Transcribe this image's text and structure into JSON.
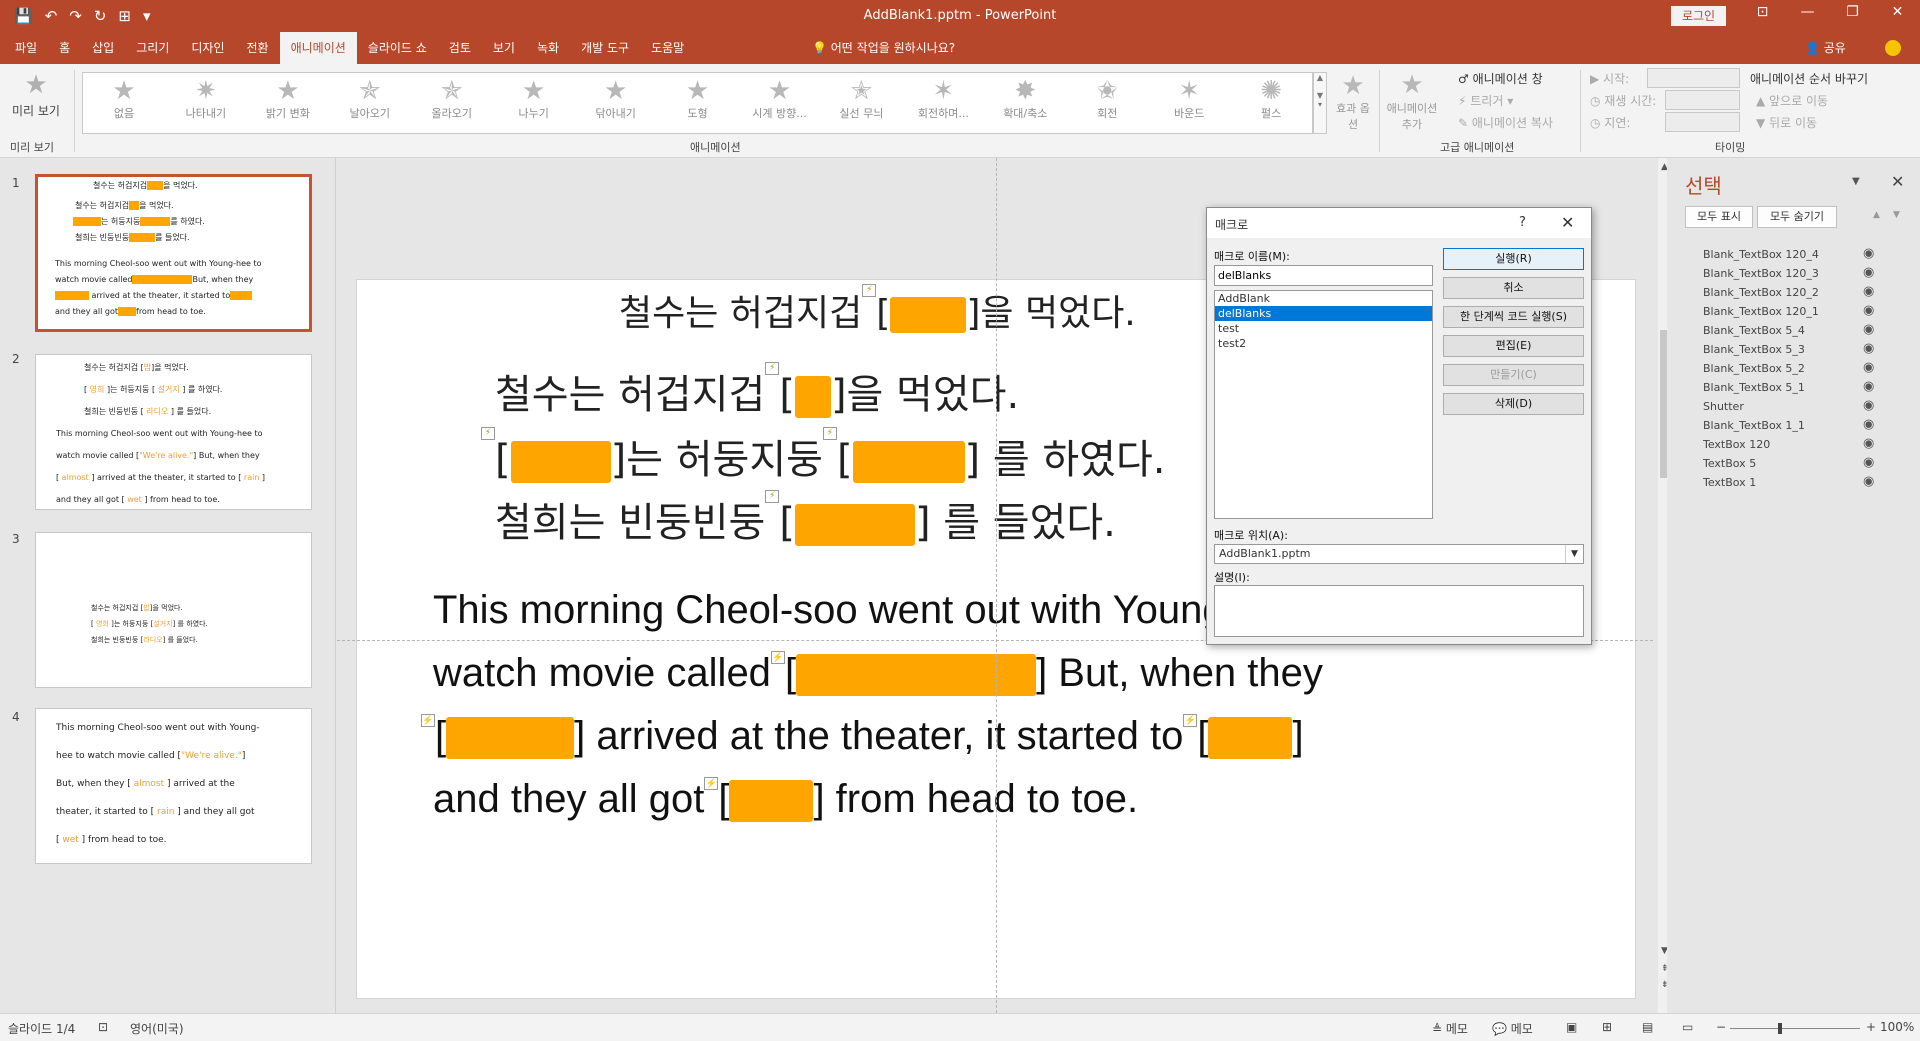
{
  "app": {
    "title": "AddBlank1.pptm - PowerPoint",
    "login": "로그인",
    "qat": [
      "💾",
      "↶",
      "↷",
      "↻",
      "⊞",
      "▾"
    ],
    "window_controls": [
      "⊡",
      "—",
      "❐",
      "✕"
    ]
  },
  "tabs": [
    "파일",
    "홈",
    "삽입",
    "그리기",
    "디자인",
    "전환",
    "애니메이션",
    "슬라이드 쇼",
    "검토",
    "보기",
    "녹화",
    "개발 도구",
    "도움말"
  ],
  "tell_me": "💡 어떤 작업을 원하시나요?",
  "share": "👤 공유",
  "ribbon": {
    "preview_label": "미리 보기",
    "preview_group": "미리 보기",
    "animations": [
      "없음",
      "나타내기",
      "밝기 변화",
      "날아오기",
      "올라오기",
      "나누기",
      "닦아내기",
      "도형",
      "시계 방향...",
      "실선 무늬",
      "회전하며...",
      "확대/축소",
      "회전",
      "바운드",
      "펄스"
    ],
    "effect_options": "효과 옵션",
    "animation_group": "애니메이션",
    "add_animation": "애니메이션 추가",
    "animation_pane": "애니메이션 창",
    "trigger": "트리거",
    "anim_painter": "애니메이션 복사",
    "advanced_group": "고급 애니메이션",
    "start": "시작:",
    "duration": "재생 시간:",
    "delay": "지연:",
    "reorder": "애니메이션 순서 바꾸기",
    "move_earlier": "앞으로 이동",
    "move_later": "뒤로 이동",
    "timing_group": "타이밍"
  },
  "thumbnails": {
    "numbers": [
      "1",
      "2",
      "3",
      "4"
    ],
    "t1": {
      "l1": "철수는 허겁지겁",
      "l1b": "을 먹었다.",
      "l2": "철수는 허겁지겁",
      "l2b": "을 먹었다.",
      "l3b": "는 허둥지둥",
      "l3c": "를 하였다.",
      "l4": "철희는 빈둥빈둥",
      "l4b": "를 들었다.",
      "e1": "This morning Cheol-soo went out with Young-hee to",
      "e2": "watch movie called",
      "e2b": "But, when they",
      "e3": "arrived at the theater, it started to",
      "e4": "and they all got",
      "e4b": "from head to toe."
    },
    "t2": {
      "l1": "철수는 허겁지겁",
      "w1": "밥",
      "l1b": "을 먹었다.",
      "w2": "영희",
      "l2b": "는 허둥지둥",
      "w3": "설거지",
      "l2c": "를 하였다.",
      "l3": "철희는 빈둥빈둥",
      "w4": "라디오",
      "l3b": "를 들었다.",
      "e1": "This morning Cheol-soo went out with Young-hee to",
      "e2": "watch movie called",
      "w5": "\"We're alive.\"",
      "e2b": "But, when they",
      "w6": "almost",
      "e3": "arrived at the theater, it started to",
      "w7": "rain",
      "e4": "and they all got",
      "w8": "wet",
      "e4b": "from head to toe."
    },
    "t3": {
      "l1": "철수는 허겁지겁",
      "w1": "밥",
      "l1b": "을 먹었다.",
      "w2": "영희",
      "l2b": "는 허둥지둥",
      "w3": "설거지",
      "l2c": "를 하였다.",
      "l3": "철희는 빈둥빈둥",
      "w4": "라디오",
      "l3b": "를 들었다."
    },
    "t4": {
      "e1": "This morning Cheol-soo went out with Young-",
      "e2": "hee to watch movie called",
      "w1": "\"We're alive.\"",
      "e3": "But, when they",
      "w2": "almost",
      "e3b": "arrived at the",
      "e4": "theater, it started to",
      "w3": "rain",
      "e4b": "and they all got",
      "w4": "wet",
      "e5": "from head to toe."
    }
  },
  "slide": {
    "k_title_a": "철수는 허겁지겁",
    "k_title_b": "]을 먹었다.",
    "k1a": "철수는 허겁지겁",
    "k1b": "]을 먹었다.",
    "k2b": "]는 허둥지둥",
    "k2c": "] 를 하였다.",
    "k3a": "철희는 빈둥빈둥",
    "k3b": "] 를 들었다.",
    "e1": "This morning Cheol-soo went out with Young-hee to",
    "e2a": "watch movie called",
    "e2b": "] But, when they",
    "e3b": "]  arrived at the theater, it started to",
    "e3c": "]",
    "e4a": "and they all got",
    "e4b": "] from head to toe.",
    "open_bracket": "[",
    "trigger_icon": "⚡"
  },
  "macro_dialog": {
    "title": "매크로",
    "help": "?",
    "close": "✕",
    "name_label": "매크로 이름(M):",
    "name_value": "delBlanks",
    "macros": [
      "AddBlank",
      "delBlanks",
      "test",
      "test2"
    ],
    "selected": "delBlanks",
    "buttons": [
      "실행(R)",
      "취소",
      "한 단계씩 코드 실행(S)",
      "편집(E)",
      "만들기(C)",
      "삭제(D)"
    ],
    "location_label": "매크로 위치(A):",
    "location_value": "AddBlank1.pptm",
    "description_label": "설명(I):"
  },
  "selection_pane": {
    "title": "선택",
    "show_all": "모두 표시",
    "hide_all": "모두 숨기기",
    "items": [
      "Blank_TextBox 120_4",
      "Blank_TextBox 120_3",
      "Blank_TextBox 120_2",
      "Blank_TextBox 120_1",
      "Blank_TextBox 5_4",
      "Blank_TextBox 5_3",
      "Blank_TextBox 5_2",
      "Blank_TextBox 5_1",
      "Shutter",
      "Blank_TextBox 1_1",
      "TextBox 120",
      "TextBox 5",
      "TextBox 1"
    ]
  },
  "status": {
    "slide": "슬라이드 1/4",
    "language": "영어(미국)",
    "notes": "≜ 메모",
    "comments": "💬 메모",
    "zoom": "100%"
  },
  "colors": {
    "accent": "#b7472a",
    "blank": "#ffa500",
    "select": "#0078d7"
  }
}
